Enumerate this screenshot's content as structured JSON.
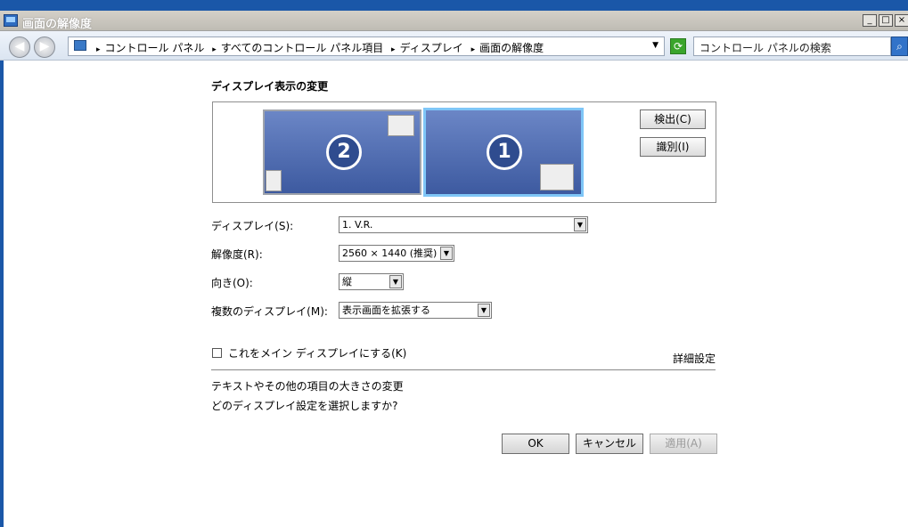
{
  "window": {
    "title": "画面の解像度"
  },
  "nav": {
    "crumbs": [
      "コントロール パネル",
      "すべてのコントロール パネル項目",
      "ディスプレイ",
      "画面の解像度"
    ],
    "search_placeholder": "コントロール パネルの検索"
  },
  "main": {
    "heading": "ディスプレイ表示の変更",
    "monitors": [
      {
        "number": "2"
      },
      {
        "number": "1"
      }
    ],
    "detect_label": "検出(C)",
    "identify_label": "識別(I)",
    "display_label": "ディスプレイ(S):",
    "display_value": "1. V.R.",
    "resolution_label": "解像度(R):",
    "resolution_value": "2560 × 1440 (推奨)",
    "orientation_label": "向き(O):",
    "orientation_value": "縦",
    "multi_label": "複数のディスプレイ(M):",
    "multi_value": "表示画面を拡張する",
    "main_display_label": "これをメイン ディスプレイにする(K)",
    "advanced_label": "詳細設定",
    "link_text_size": "テキストやその他の項目の大きさの変更",
    "link_which": "どのディスプレイ設定を選択しますか?"
  },
  "buttons": {
    "ok": "OK",
    "cancel": "キャンセル",
    "apply": "適用(A)"
  },
  "colors": {
    "accent": "#7fc6f7",
    "titlebar": "#1a57a8",
    "monitor": "#4d68ae"
  }
}
